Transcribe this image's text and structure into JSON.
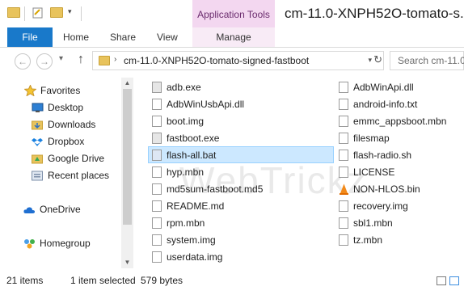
{
  "title_bar": {
    "contextual_tab": "Application Tools",
    "window_title": "cm-11.0-XNPH52O-tomato-s..."
  },
  "ribbon": {
    "file": "File",
    "home": "Home",
    "share": "Share",
    "view": "View",
    "manage": "Manage"
  },
  "address": {
    "path": "cm-11.0-XNPH52O-tomato-signed-fastboot",
    "search_placeholder": "Search cm-11.0..."
  },
  "nav": {
    "favorites": "Favorites",
    "desktop": "Desktop",
    "downloads": "Downloads",
    "dropbox": "Dropbox",
    "google_drive": "Google Drive",
    "recent": "Recent places",
    "onedrive": "OneDrive",
    "homegroup": "Homegroup"
  },
  "files_col1": [
    "adb.exe",
    "AdbWinUsbApi.dll",
    "boot.img",
    "fastboot.exe",
    "flash-all.bat",
    "hyp.mbn",
    "md5sum-fastboot.md5",
    "README.md",
    "rpm.mbn",
    "system.img",
    "userdata.img"
  ],
  "files_col2": [
    "AdbWinApi.dll",
    "android-info.txt",
    "emmc_appsboot.mbn",
    "filesmap",
    "flash-radio.sh",
    "LICENSE",
    "NON-HLOS.bin",
    "recovery.img",
    "sbl1.mbn",
    "tz.mbn"
  ],
  "watermark": "WebTrickz",
  "status": {
    "items": "21 items",
    "selected": "1 item selected",
    "size": "579 bytes"
  },
  "colors": {
    "accent": "#1979ca",
    "contextual": "#f3d7f0",
    "selection": "#cce8ff"
  }
}
